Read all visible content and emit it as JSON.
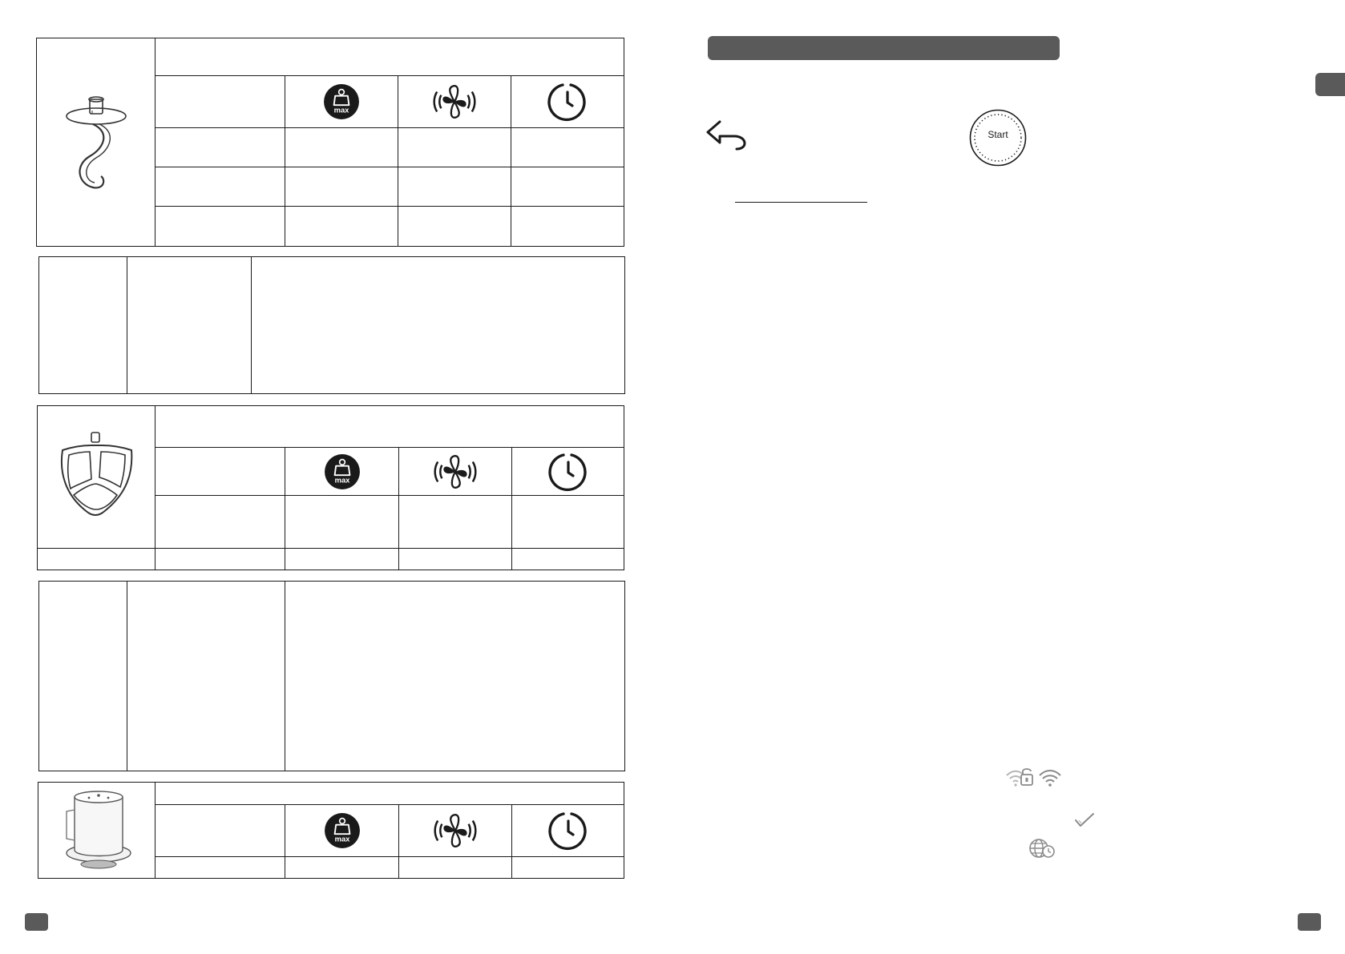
{
  "right_page": {
    "start_button_label": "Start"
  },
  "icons": {
    "weight": "weight-max-icon",
    "speed": "speed-icon",
    "timer": "timer-icon",
    "back": "back-arrow-icon",
    "wifi": "wifi-icon",
    "lock": "lock-icon",
    "check": "check-icon",
    "globe_clock": "globe-clock-icon"
  },
  "colors": {
    "header_bar": "#5a5a5a",
    "ink": "#1a1a1a",
    "light_icon": "#9a9a9a"
  }
}
